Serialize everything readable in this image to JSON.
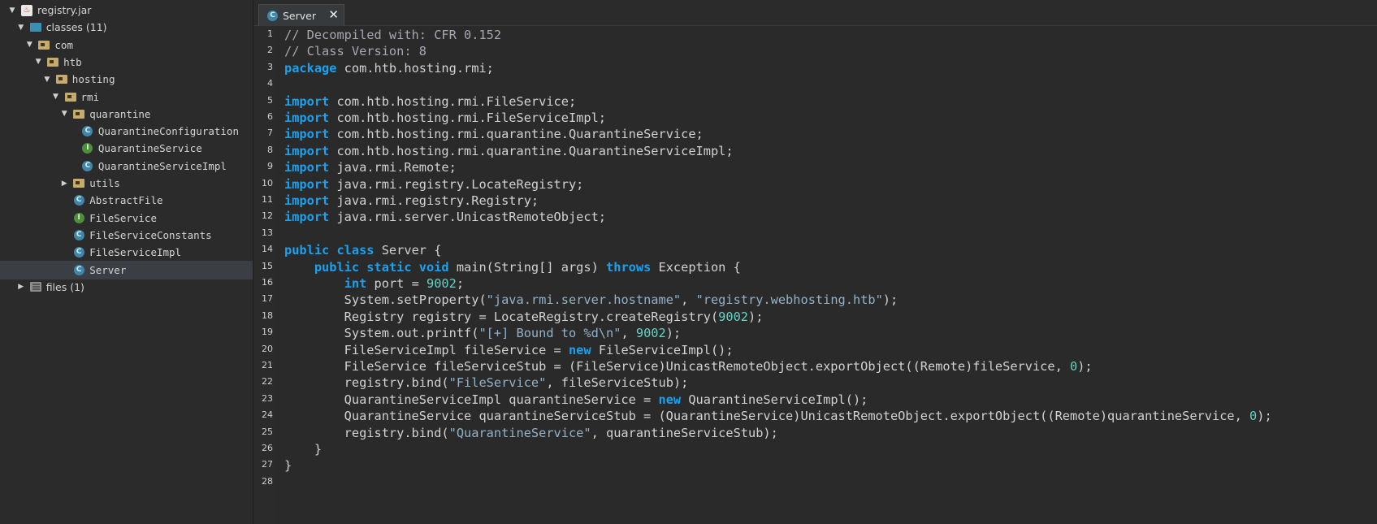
{
  "tree": {
    "items": [
      {
        "label": "registry.jar",
        "depth": 0,
        "expanded": true,
        "icon": "jar-icon",
        "mono": false,
        "selected": false
      },
      {
        "label": "classes (11)",
        "depth": 1,
        "expanded": true,
        "icon": "classes-folder-icon",
        "mono": false,
        "selected": false
      },
      {
        "label": "com",
        "depth": 2,
        "expanded": true,
        "icon": "package-folder-icon",
        "mono": true,
        "selected": false
      },
      {
        "label": "htb",
        "depth": 3,
        "expanded": true,
        "icon": "package-folder-icon",
        "mono": true,
        "selected": false
      },
      {
        "label": "hosting",
        "depth": 4,
        "expanded": true,
        "icon": "package-folder-icon",
        "mono": true,
        "selected": false
      },
      {
        "label": "rmi",
        "depth": 5,
        "expanded": true,
        "icon": "package-folder-icon",
        "mono": true,
        "selected": false
      },
      {
        "label": "quarantine",
        "depth": 6,
        "expanded": true,
        "icon": "package-folder-icon",
        "mono": true,
        "selected": false
      },
      {
        "label": "QuarantineConfiguration",
        "depth": 7,
        "expanded": null,
        "icon": "class-icon",
        "mono": true,
        "selected": false
      },
      {
        "label": "QuarantineService",
        "depth": 7,
        "expanded": null,
        "icon": "interface-icon",
        "mono": true,
        "selected": false
      },
      {
        "label": "QuarantineServiceImpl",
        "depth": 7,
        "expanded": null,
        "icon": "class-icon",
        "mono": true,
        "selected": false
      },
      {
        "label": "utils",
        "depth": 6,
        "expanded": false,
        "icon": "package-folder-icon",
        "mono": true,
        "selected": false
      },
      {
        "label": "AbstractFile",
        "depth": 6,
        "expanded": null,
        "icon": "class-icon",
        "mono": true,
        "selected": false
      },
      {
        "label": "FileService",
        "depth": 6,
        "expanded": null,
        "icon": "interface-icon",
        "mono": true,
        "selected": false
      },
      {
        "label": "FileServiceConstants",
        "depth": 6,
        "expanded": null,
        "icon": "class-icon",
        "mono": true,
        "selected": false
      },
      {
        "label": "FileServiceImpl",
        "depth": 6,
        "expanded": null,
        "icon": "class-icon",
        "mono": true,
        "selected": false
      },
      {
        "label": "Server",
        "depth": 6,
        "expanded": null,
        "icon": "class-icon",
        "mono": true,
        "selected": true
      },
      {
        "label": "files (1)",
        "depth": 1,
        "expanded": false,
        "icon": "files-icon",
        "mono": false,
        "selected": false
      }
    ]
  },
  "tab": {
    "label": "Server",
    "close_glyph": "✕"
  },
  "code": {
    "lines": [
      [
        [
          "com",
          "// Decompiled with: CFR 0.152"
        ]
      ],
      [
        [
          "com",
          "// Class Version: 8"
        ]
      ],
      [
        [
          "kw",
          "package"
        ],
        [
          "plain",
          " com.htb.hosting.rmi;"
        ]
      ],
      [],
      [
        [
          "kw",
          "import"
        ],
        [
          "plain",
          " com.htb.hosting.rmi.FileService;"
        ]
      ],
      [
        [
          "kw",
          "import"
        ],
        [
          "plain",
          " com.htb.hosting.rmi.FileServiceImpl;"
        ]
      ],
      [
        [
          "kw",
          "import"
        ],
        [
          "plain",
          " com.htb.hosting.rmi.quarantine.QuarantineService;"
        ]
      ],
      [
        [
          "kw",
          "import"
        ],
        [
          "plain",
          " com.htb.hosting.rmi.quarantine.QuarantineServiceImpl;"
        ]
      ],
      [
        [
          "kw",
          "import"
        ],
        [
          "plain",
          " java.rmi.Remote;"
        ]
      ],
      [
        [
          "kw",
          "import"
        ],
        [
          "plain",
          " java.rmi.registry.LocateRegistry;"
        ]
      ],
      [
        [
          "kw",
          "import"
        ],
        [
          "plain",
          " java.rmi.registry.Registry;"
        ]
      ],
      [
        [
          "kw",
          "import"
        ],
        [
          "plain",
          " java.rmi.server.UnicastRemoteObject;"
        ]
      ],
      [],
      [
        [
          "kw",
          "public class"
        ],
        [
          "plain",
          " Server {"
        ]
      ],
      [
        [
          "plain",
          "    "
        ],
        [
          "kw",
          "public static void"
        ],
        [
          "plain",
          " main(String[] args) "
        ],
        [
          "kw",
          "throws"
        ],
        [
          "plain",
          " Exception {"
        ]
      ],
      [
        [
          "plain",
          "        "
        ],
        [
          "kw",
          "int"
        ],
        [
          "plain",
          " port = "
        ],
        [
          "num",
          "9002"
        ],
        [
          "plain",
          ";"
        ]
      ],
      [
        [
          "plain",
          "        System.setProperty("
        ],
        [
          "str",
          "\"java.rmi.server.hostname\""
        ],
        [
          "plain",
          ", "
        ],
        [
          "str",
          "\"registry.webhosting.htb\""
        ],
        [
          "plain",
          ");"
        ]
      ],
      [
        [
          "plain",
          "        Registry registry = LocateRegistry.createRegistry("
        ],
        [
          "num",
          "9002"
        ],
        [
          "plain",
          ");"
        ]
      ],
      [
        [
          "plain",
          "        System.out.printf("
        ],
        [
          "str",
          "\"[+] Bound to %d\\n\""
        ],
        [
          "plain",
          ", "
        ],
        [
          "num",
          "9002"
        ],
        [
          "plain",
          ");"
        ]
      ],
      [
        [
          "plain",
          "        FileServiceImpl fileService = "
        ],
        [
          "kw",
          "new"
        ],
        [
          "plain",
          " FileServiceImpl();"
        ]
      ],
      [
        [
          "plain",
          "        FileService fileServiceStub = (FileService)UnicastRemoteObject.exportObject((Remote)fileService, "
        ],
        [
          "num",
          "0"
        ],
        [
          "plain",
          ");"
        ]
      ],
      [
        [
          "plain",
          "        registry.bind("
        ],
        [
          "str",
          "\"FileService\""
        ],
        [
          "plain",
          ", fileServiceStub);"
        ]
      ],
      [
        [
          "plain",
          "        QuarantineServiceImpl quarantineService = "
        ],
        [
          "kw",
          "new"
        ],
        [
          "plain",
          " QuarantineServiceImpl();"
        ]
      ],
      [
        [
          "plain",
          "        QuarantineService quarantineServiceStub = (QuarantineService)UnicastRemoteObject.exportObject((Remote)quarantineService, "
        ],
        [
          "num",
          "0"
        ],
        [
          "plain",
          ");"
        ]
      ],
      [
        [
          "plain",
          "        registry.bind("
        ],
        [
          "str",
          "\"QuarantineService\""
        ],
        [
          "plain",
          ", quarantineServiceStub);"
        ]
      ],
      [
        [
          "plain",
          "    }"
        ]
      ],
      [
        [
          "plain",
          "}"
        ]
      ],
      []
    ]
  },
  "colors": {
    "keyword": "#1aa1ef",
    "string": "#93b2c8",
    "number": "#63d3c6",
    "comment": "#a7a7b3",
    "selection": "#3b3f45"
  }
}
